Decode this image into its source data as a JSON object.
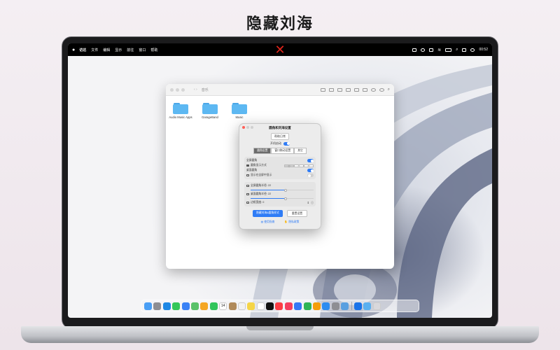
{
  "headline": "隐藏刘海",
  "menubar": {
    "items": [
      "访达",
      "文件",
      "编辑",
      "显示",
      "前往",
      "窗口",
      "帮助"
    ],
    "time": "00:52",
    "notch_marker": "✕"
  },
  "finder": {
    "title": "音乐",
    "folders": [
      "Audio Music Apps",
      "GarageBand",
      "Music"
    ]
  },
  "dialog": {
    "title": "圆角和刘海设置",
    "help_button": "帮助日常",
    "launch_at_login_label": "开机启动",
    "tabs": [
      "圆角设置",
      "窗口拖动设置",
      "其它"
    ],
    "fullscreen_corners_label": "全屏圆角",
    "corner_display_mode_label": "圆角显示方式",
    "desktop_corners_label": "桌面圆角",
    "show_in_fullscreen_label": "显示在全屏中显示",
    "fullscreen_radius_label": "全屏圆角半径: 22",
    "desktop_radius_label": "桌面圆角半径: 22",
    "notch_label": "边框宽度: 0",
    "primary_button": "隐藏刘海&圆角样式",
    "secondary_button": "重置设置",
    "link_left": "使用指南",
    "link_right": "隐私政策",
    "fullscreen_radius_value": 0.55,
    "desktop_radius_value": 0.55
  },
  "colors": {
    "accent": "#2f7cf6",
    "notch_marker": "#e0241b"
  },
  "dock": {
    "icons": [
      "finder-icon",
      "launchpad-icon",
      "safari-icon",
      "messages-icon",
      "mail-icon",
      "maps-icon",
      "photos-icon",
      "facetime-icon",
      "calendar-icon",
      "contacts-icon",
      "reminders-icon",
      "notes-icon",
      "freeform-icon",
      "appletv-icon",
      "music-icon",
      "news-icon",
      "keynote-icon",
      "numbers-icon",
      "pages-icon",
      "appstore-icon",
      "settings-icon",
      "preview-icon",
      "xcode-icon",
      "downloads-icon",
      "trash-icon"
    ],
    "calendar_day": "14"
  }
}
